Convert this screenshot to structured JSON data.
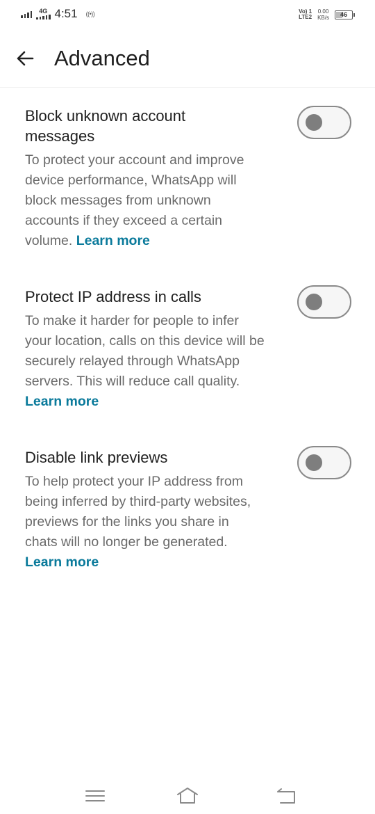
{
  "status_bar": {
    "network_type": "4G",
    "time": "4:51",
    "hotspot_icon": "hotspot-icon",
    "volte_top": "Vo) 1",
    "volte_bottom": "LTE2",
    "speed_value": "0.00",
    "speed_unit": "KB/s",
    "battery": "46"
  },
  "app_bar": {
    "title": "Advanced",
    "back_icon": "arrow-left-icon"
  },
  "settings": [
    {
      "title": "Block unknown account messages",
      "description": "To protect your account and improve device performance, WhatsApp will block messages from unknown accounts if they exceed a certain volume.",
      "link": "Learn more",
      "enabled": false
    },
    {
      "title": "Protect IP address in calls",
      "description": "To make it harder for people to infer your location, calls on this device will be securely relayed through WhatsApp servers. This will reduce call quality.",
      "link": "Learn more",
      "enabled": false
    },
    {
      "title": "Disable link previews",
      "description": "To help protect your IP address from being inferred by third-party websites, previews for the links you share in chats will no longer be generated.",
      "link": "Learn more",
      "enabled": false
    }
  ],
  "nav_bar": {
    "menu_icon": "menu-icon",
    "home_icon": "home-icon",
    "back_icon": "back-icon"
  },
  "colors": {
    "link": "#0a7a9b",
    "toggle_off_knob": "#7e7e7e",
    "toggle_off_border": "#8a8a8a"
  }
}
